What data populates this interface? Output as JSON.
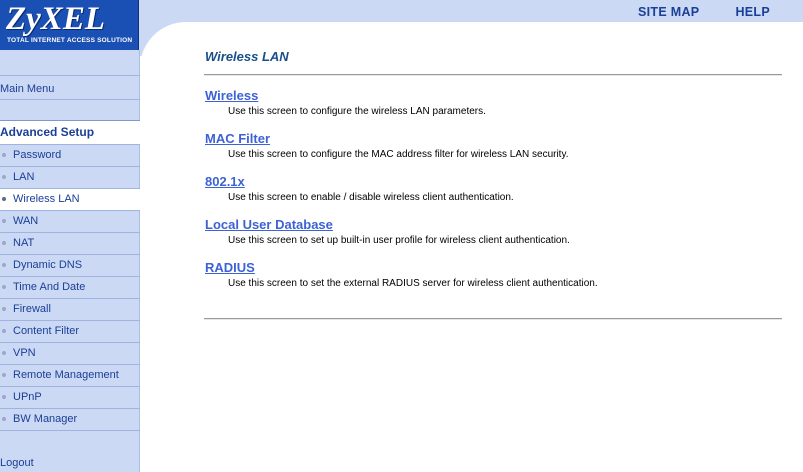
{
  "header": {
    "logo_text": "ZyXEL",
    "logo_tagline": "TOTAL INTERNET ACCESS SOLUTION",
    "links": [
      "SITE MAP",
      "HELP"
    ]
  },
  "sidebar": {
    "main_menu": "Main Menu",
    "section_title": "Advanced Setup",
    "items": [
      "Password",
      "LAN",
      "Wireless LAN",
      "WAN",
      "NAT",
      "Dynamic DNS",
      "Time And Date",
      "Firewall",
      "Content Filter",
      "VPN",
      "Remote Management",
      "UPnP",
      "BW Manager"
    ],
    "active_item": "Wireless LAN",
    "logout": "Logout"
  },
  "main": {
    "title": "Wireless LAN",
    "entries": [
      {
        "link": "Wireless",
        "description": "Use this screen to configure the wireless LAN parameters."
      },
      {
        "link": "MAC Filter",
        "description": "Use this screen to configure the MAC address filter for wireless LAN security."
      },
      {
        "link": "802.1x",
        "description": "Use this screen to enable / disable wireless client authentication."
      },
      {
        "link": "Local User Database",
        "description": "Use this screen to set up built-in user profile for wireless client authentication."
      },
      {
        "link": "RADIUS",
        "description": "Use this screen to set the external RADIUS server for wireless client authentication."
      }
    ]
  },
  "colors": {
    "brand_blue": "#1a4fb3",
    "panel_bg": "#ccd9f5",
    "link_blue": "#3d62d6"
  }
}
